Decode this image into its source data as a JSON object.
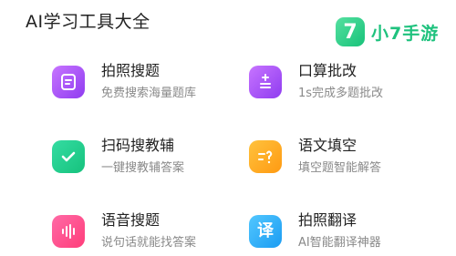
{
  "header": {
    "title": "AI学习工具大全"
  },
  "watermark": {
    "badge": "7",
    "text": "小7手游"
  },
  "tools": [
    {
      "name": "拍照搜题",
      "desc": "免费搜索海量题库",
      "icon": "document-icon",
      "color": "#9b4df5"
    },
    {
      "name": "口算批改",
      "desc": "1s完成多题批改",
      "icon": "calculator-icon",
      "color": "#9b4df5"
    },
    {
      "name": "扫码搜教辅",
      "desc": "一键搜教辅答案",
      "icon": "checkmark-icon",
      "color": "#1fc27e"
    },
    {
      "name": "语文填空",
      "desc": "填空题智能解答",
      "icon": "fill-blank-icon",
      "color": "#ffa21a"
    },
    {
      "name": "语音搜题",
      "desc": "说句话就能找答案",
      "icon": "voice-wave-icon",
      "color": "#ff4a85"
    },
    {
      "name": "拍照翻译",
      "desc": "AI智能翻译神器",
      "icon": "translate-icon",
      "color": "#2aa8f5",
      "glyph": "译"
    }
  ]
}
